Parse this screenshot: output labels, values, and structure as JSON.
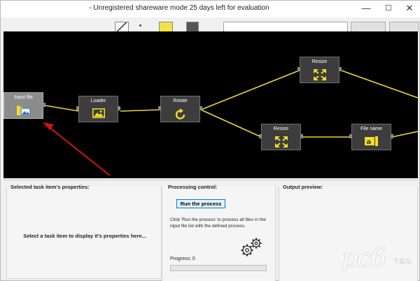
{
  "window": {
    "title": "- Unregistered shareware mode 25 days left for evaluation",
    "controls": {
      "minimize": "—",
      "maximize": "☐",
      "close": "✕"
    }
  },
  "nodes": {
    "input_file": "Input file",
    "loader": "Loader",
    "rotate": "Rotate",
    "resize_top": "Resize",
    "resize_bottom": "Resize",
    "file_name": "File name"
  },
  "icons": {
    "input_file": "folder-image-icon",
    "loader": "image-icon",
    "rotate": "rotate-icon",
    "resize": "expand-arrows-icon",
    "file_name": "text-cursor-icon",
    "gears": "gears-icon"
  },
  "colors": {
    "wire": "#e8d830",
    "node_icon": "#f2dc2a",
    "annotation_arrow": "#d01515",
    "canvas_bg": "#000000",
    "selected_node": "#8c8c8c",
    "run_button_border": "#0078d7"
  },
  "panels": {
    "properties": {
      "title": "Selected task item's properties:",
      "message": "Select a task item to display it's properties here..."
    },
    "processing": {
      "title": "Processing control:",
      "run_button": "Run the process",
      "description": "Click 'Run the process' to process all files in the input file list with the defined process.",
      "progress_label": "Progress:",
      "progress_value": "0",
      "progress_fraction": 0
    },
    "output": {
      "title": "Output preview:"
    }
  },
  "watermark": {
    "text": "pc6",
    "sub": "下载站"
  }
}
